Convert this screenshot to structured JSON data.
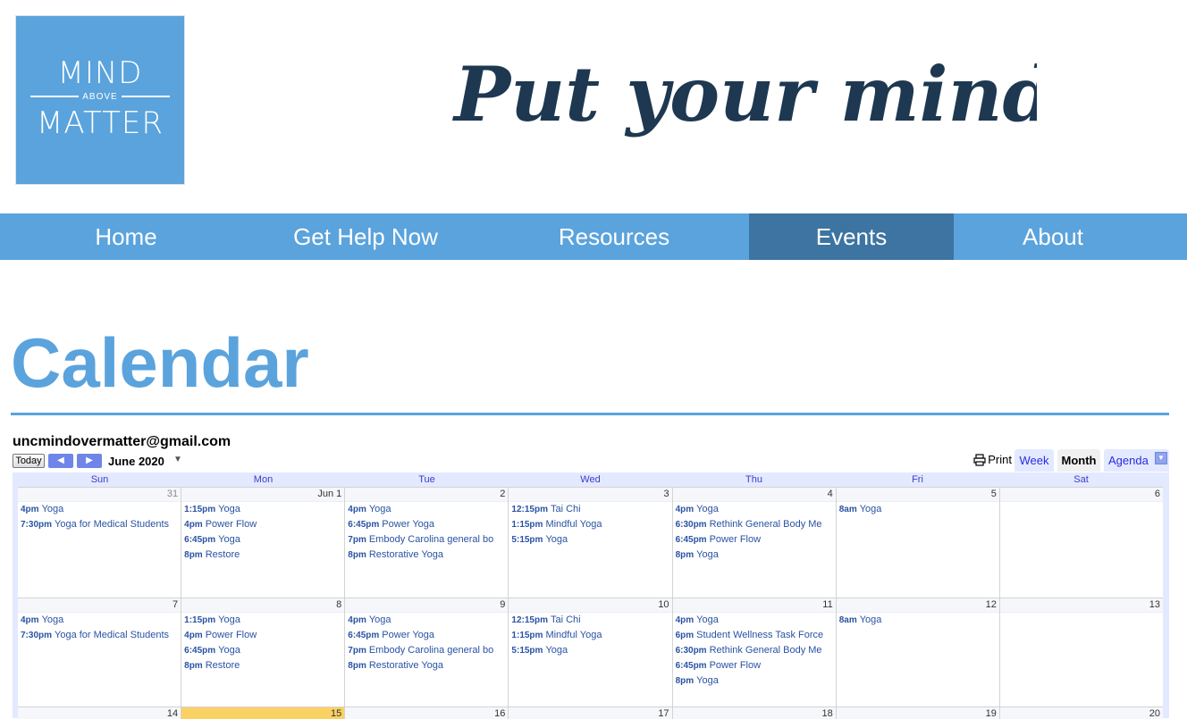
{
  "logo": {
    "line1": "MIND",
    "line2": "ABOVE",
    "line3": "MATTER"
  },
  "tagline": "Put your mind first",
  "nav": {
    "items": [
      {
        "label": "Home"
      },
      {
        "label": "Get Help Now"
      },
      {
        "label": "Resources"
      },
      {
        "label": "Events",
        "active": true
      },
      {
        "label": "About"
      }
    ]
  },
  "page": {
    "title": "Calendar"
  },
  "colors": {
    "brand_blue": "#5ba3dc",
    "nav_active": "#3d74a1",
    "heading_dark": "#1e3851",
    "event_link": "#2952a3",
    "today": "#fad163"
  },
  "calendar": {
    "owner": "uncmindovermatter@gmail.com",
    "today_label": "Today",
    "prev_icon": "arrow-left-icon",
    "next_icon": "arrow-right-icon",
    "month_label": "June 2020",
    "print_label": "Print",
    "views": [
      "Week",
      "Month",
      "Agenda"
    ],
    "active_view": "Month",
    "dow": [
      "Sun",
      "Mon",
      "Tue",
      "Wed",
      "Thu",
      "Fri",
      "Sat"
    ],
    "weeks": [
      {
        "days": [
          {
            "num": "31",
            "other": true,
            "events": [
              {
                "time": "4pm",
                "title": "Yoga"
              },
              {
                "time": "7:30pm",
                "title": "Yoga for Medical Students"
              }
            ]
          },
          {
            "num": "Jun 1",
            "events": [
              {
                "time": "1:15pm",
                "title": "Yoga"
              },
              {
                "time": "4pm",
                "title": "Power Flow"
              },
              {
                "time": "6:45pm",
                "title": "Yoga"
              },
              {
                "time": "8pm",
                "title": "Restore"
              }
            ]
          },
          {
            "num": "2",
            "events": [
              {
                "time": "4pm",
                "title": "Yoga"
              },
              {
                "time": "6:45pm",
                "title": "Power Yoga"
              },
              {
                "time": "7pm",
                "title": "Embody Carolina general bo"
              },
              {
                "time": "8pm",
                "title": "Restorative Yoga"
              }
            ]
          },
          {
            "num": "3",
            "events": [
              {
                "time": "12:15pm",
                "title": "Tai Chi"
              },
              {
                "time": "1:15pm",
                "title": "Mindful Yoga"
              },
              {
                "time": "5:15pm",
                "title": "Yoga"
              }
            ]
          },
          {
            "num": "4",
            "events": [
              {
                "time": "4pm",
                "title": "Yoga"
              },
              {
                "time": "6:30pm",
                "title": "Rethink General Body Me"
              },
              {
                "time": "6:45pm",
                "title": "Power Flow"
              },
              {
                "time": "8pm",
                "title": "Yoga"
              }
            ]
          },
          {
            "num": "5",
            "events": [
              {
                "time": "8am",
                "title": "Yoga"
              }
            ]
          },
          {
            "num": "6",
            "events": []
          }
        ]
      },
      {
        "days": [
          {
            "num": "7",
            "events": [
              {
                "time": "4pm",
                "title": "Yoga"
              },
              {
                "time": "7:30pm",
                "title": "Yoga for Medical Students"
              }
            ]
          },
          {
            "num": "8",
            "events": [
              {
                "time": "1:15pm",
                "title": "Yoga"
              },
              {
                "time": "4pm",
                "title": "Power Flow"
              },
              {
                "time": "6:45pm",
                "title": "Yoga"
              },
              {
                "time": "8pm",
                "title": "Restore"
              }
            ]
          },
          {
            "num": "9",
            "events": [
              {
                "time": "4pm",
                "title": "Yoga"
              },
              {
                "time": "6:45pm",
                "title": "Power Yoga"
              },
              {
                "time": "7pm",
                "title": "Embody Carolina general bo"
              },
              {
                "time": "8pm",
                "title": "Restorative Yoga"
              }
            ]
          },
          {
            "num": "10",
            "events": [
              {
                "time": "12:15pm",
                "title": "Tai Chi"
              },
              {
                "time": "1:15pm",
                "title": "Mindful Yoga"
              },
              {
                "time": "5:15pm",
                "title": "Yoga"
              }
            ]
          },
          {
            "num": "11",
            "events": [
              {
                "time": "4pm",
                "title": "Yoga"
              },
              {
                "time": "6pm",
                "title": "Student Wellness Task Force"
              },
              {
                "time": "6:30pm",
                "title": "Rethink General Body Me"
              },
              {
                "time": "6:45pm",
                "title": "Power Flow"
              },
              {
                "time": "8pm",
                "title": "Yoga"
              }
            ]
          },
          {
            "num": "12",
            "events": [
              {
                "time": "8am",
                "title": "Yoga"
              }
            ]
          },
          {
            "num": "13",
            "events": []
          }
        ]
      },
      {
        "days": [
          {
            "num": "14",
            "events": []
          },
          {
            "num": "15",
            "today": true,
            "events": []
          },
          {
            "num": "16",
            "events": []
          },
          {
            "num": "17",
            "events": []
          },
          {
            "num": "18",
            "events": []
          },
          {
            "num": "19",
            "events": []
          },
          {
            "num": "20",
            "events": []
          }
        ]
      }
    ]
  }
}
